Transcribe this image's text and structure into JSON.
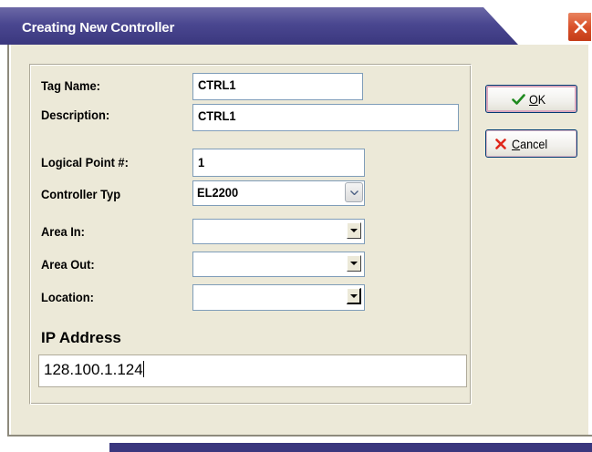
{
  "window": {
    "title": "Creating New Controller",
    "close_icon": "close-x-icon",
    "accent": "#3a377e",
    "close_color": "#d9512a"
  },
  "form": {
    "tag_name": {
      "label": "Tag Name:",
      "value": "CTRL1"
    },
    "description": {
      "label": "Description:",
      "value": "CTRL1"
    },
    "logical_point": {
      "label": "Logical Point #:",
      "value": "1"
    },
    "controller_type": {
      "label": "Controller Typ",
      "value": "EL2200"
    },
    "area_in": {
      "label": "Area In:",
      "value": ""
    },
    "area_out": {
      "label": "Area Out:",
      "value": ""
    },
    "location": {
      "label": "Location:",
      "value": ""
    },
    "ip_address": {
      "label": "IP Address",
      "value": "128.100.1.124"
    }
  },
  "buttons": {
    "ok": {
      "mnemonic": "O",
      "rest": "K",
      "icon": "checkmark-icon",
      "icon_color": "#1f8a1f"
    },
    "cancel": {
      "mnemonic": "C",
      "rest": "ancel",
      "icon": "red-x-icon",
      "icon_color": "#e0261b"
    }
  }
}
